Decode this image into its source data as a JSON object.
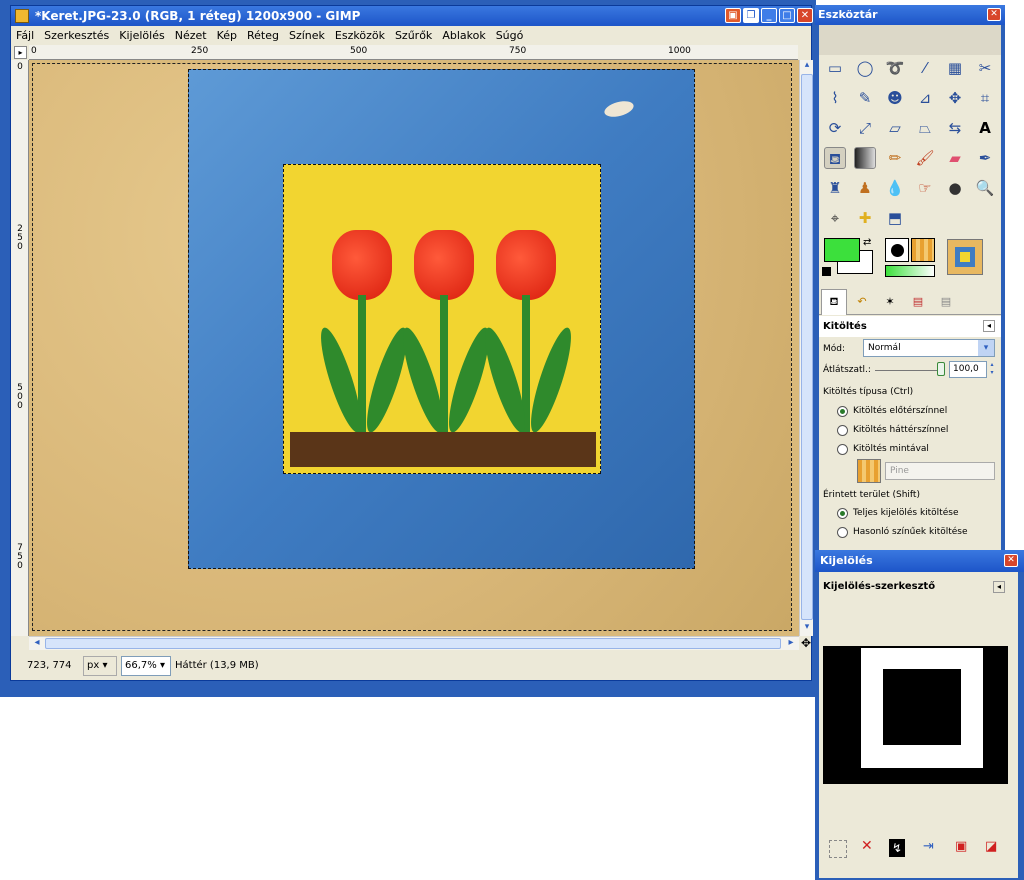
{
  "main_window": {
    "title": "*Keret.JPG-23.0 (RGB, 1 réteg) 1200x900 - GIMP",
    "menu": [
      "Fájl",
      "Szerkesztés",
      "Kijelölés",
      "Nézet",
      "Kép",
      "Réteg",
      "Színek",
      "Eszközök",
      "Szűrők",
      "Ablakok",
      "Súgó"
    ],
    "ruler_top": [
      "0",
      "250",
      "500",
      "750",
      "1000"
    ],
    "ruler_left": [
      "0",
      "250",
      "500",
      "750"
    ],
    "status": {
      "coords": "723, 774",
      "unit": "px",
      "zoom": "66,7%",
      "layer_info": "Háttér (13,9 MB)"
    }
  },
  "toolbox": {
    "title": "Eszköztár",
    "tool_options": {
      "title": "Kitöltés",
      "mode_label": "Mód:",
      "mode_value": "Normál",
      "opacity_label": "Átlátszatl.:",
      "opacity_value": "100,0",
      "fill_type_label": "Kitöltés típusa  (Ctrl)",
      "fill_options": [
        "Kitöltés előtérszínnel",
        "Kitöltés háttérszínnel",
        "Kitöltés mintával"
      ],
      "pattern_name": "Pine",
      "affected_area_label": "Érintett terület  (Shift)",
      "area_options": [
        "Teljes kijelölés kitöltése",
        "Hasonló színűek kitöltése"
      ]
    },
    "colors": {
      "foreground": "#3ce03c",
      "background": "#ffffff"
    }
  },
  "selection_editor": {
    "window_title": "Kijelölés",
    "panel_title": "Kijelölés-szerkesztő"
  }
}
